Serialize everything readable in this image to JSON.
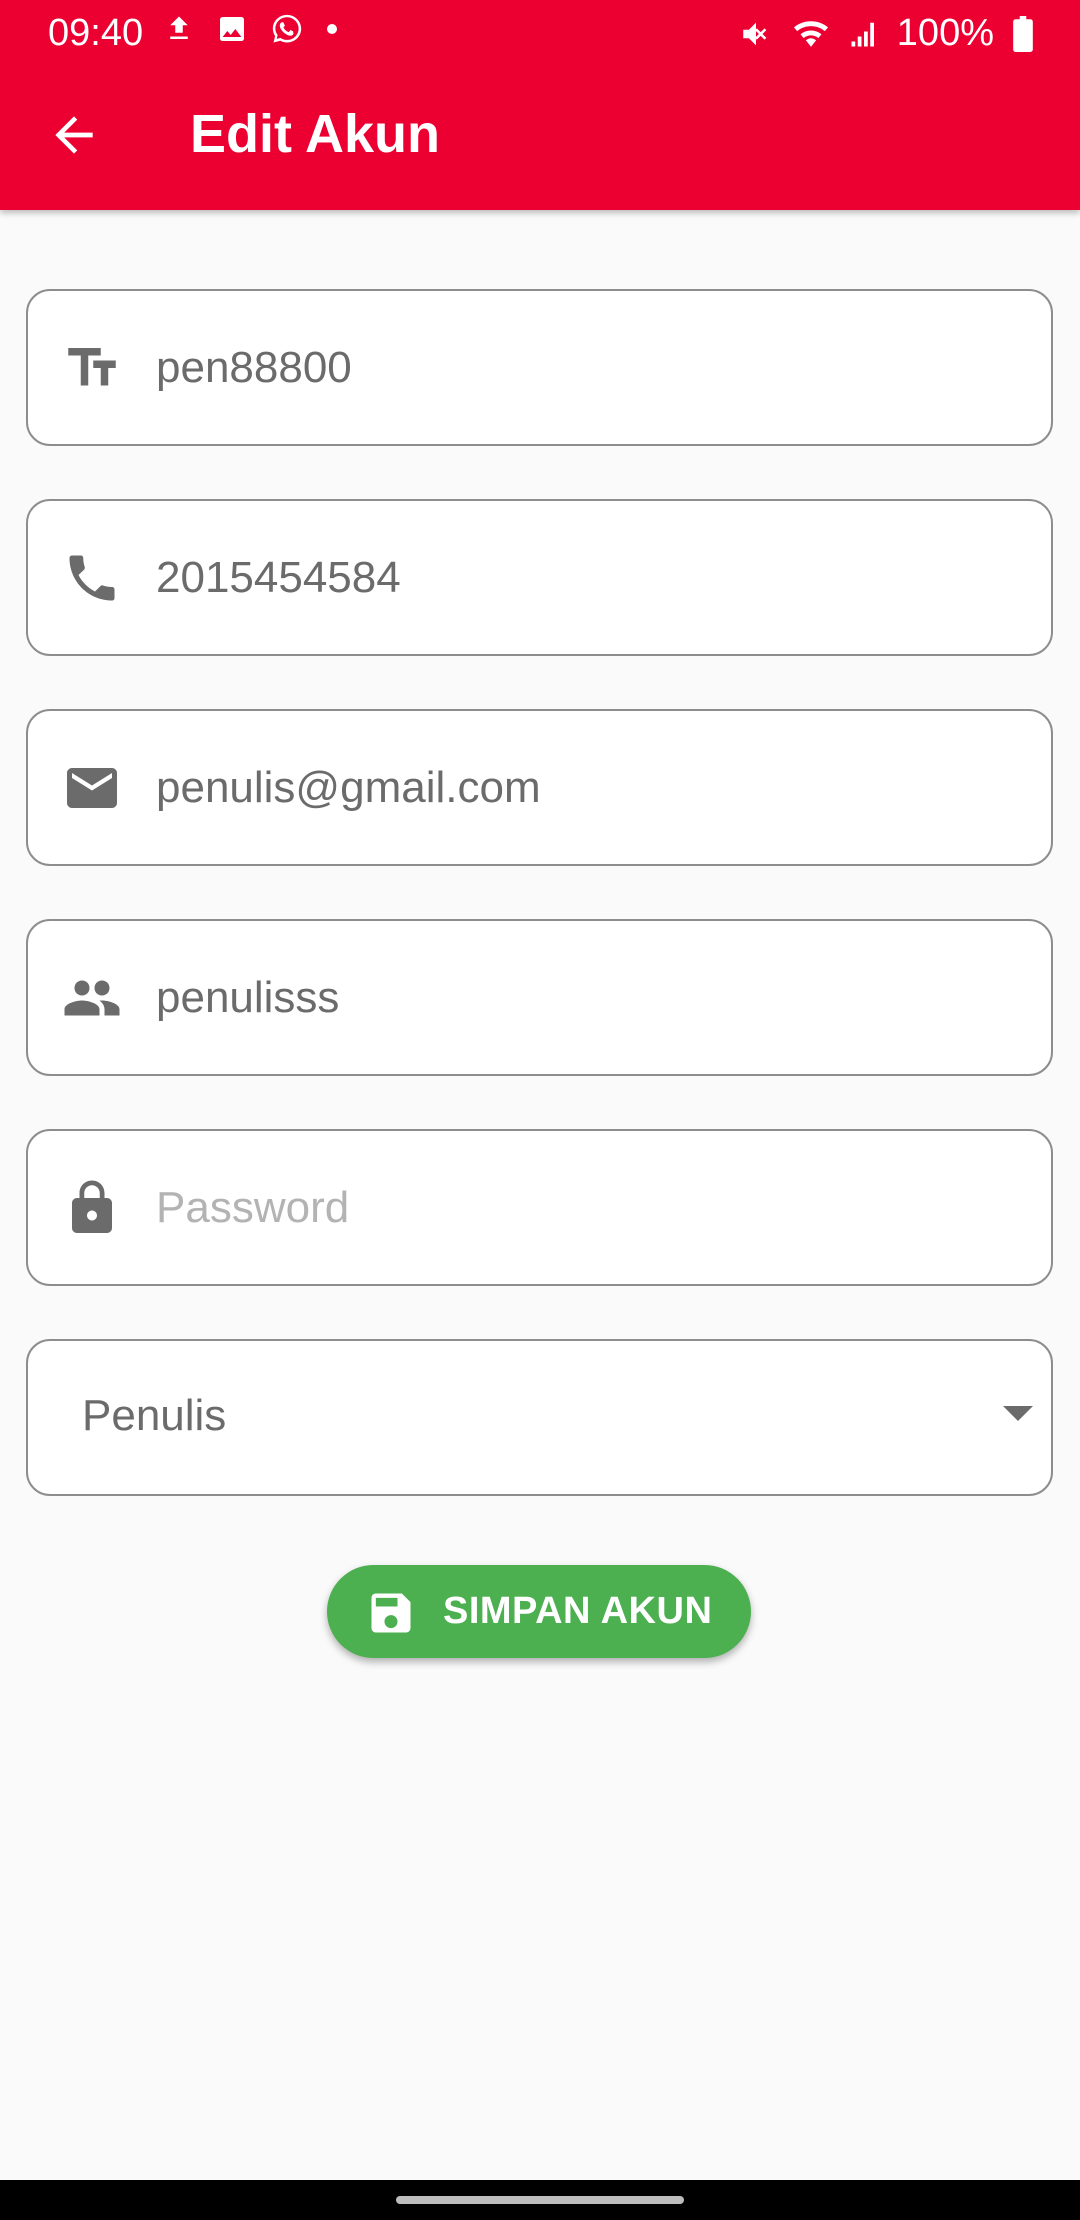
{
  "status_bar": {
    "time": "09:40",
    "battery": "100%",
    "left_icons": [
      "upload-icon",
      "image-icon",
      "whatsapp-icon",
      "dot-icon"
    ],
    "right_icons": [
      "mute-icon",
      "wifi-icon",
      "signal-icon",
      "battery-icon"
    ]
  },
  "app_bar": {
    "title": "Edit Akun",
    "back_icon": "arrow-back-icon",
    "color": "#ec0031"
  },
  "form": {
    "fields": [
      {
        "icon": "text-fields-icon",
        "value": "pen88800",
        "placeholder": ""
      },
      {
        "icon": "phone-icon",
        "value": "2015454584",
        "placeholder": ""
      },
      {
        "icon": "email-icon",
        "value": "penulis@gmail.com",
        "placeholder": ""
      },
      {
        "icon": "people-icon",
        "value": "penulisss",
        "placeholder": ""
      },
      {
        "icon": "lock-icon",
        "value": "",
        "placeholder": "Password"
      }
    ],
    "role_select": {
      "selected": "Penulis",
      "icon": "dropdown-arrow-icon"
    }
  },
  "save_button": {
    "label": "SIMPAN AKUN",
    "icon": "save-icon",
    "color": "#4caf50"
  }
}
